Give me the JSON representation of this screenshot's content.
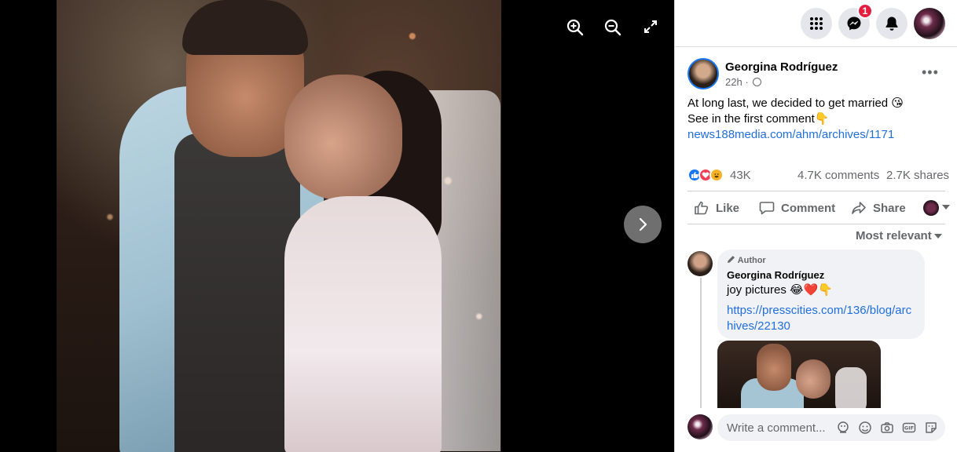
{
  "viewer": {
    "zoom_in_icon": "zoom-in-icon",
    "zoom_out_icon": "zoom-out-icon",
    "fullscreen_icon": "fullscreen-icon",
    "next_icon": "chevron-right-icon"
  },
  "topbar": {
    "menu_icon": "grid-icon",
    "messenger_icon": "messenger-icon",
    "messenger_badge": "1",
    "notifications_icon": "bell-icon"
  },
  "post": {
    "author": "Georgina Rodríguez",
    "time": "22h",
    "text_line1": "At long last, we decided to get married 😘",
    "text_line2": "See in the first comment👇",
    "link": "news188media.com/ahm/archives/1171",
    "reaction_count": "43K",
    "comments": "4.7K comments",
    "shares": "2.7K shares"
  },
  "actions": {
    "like": "Like",
    "comment": "Comment",
    "share": "Share"
  },
  "sort": {
    "label": "Most relevant"
  },
  "comment": {
    "tag": "Author",
    "name": "Georgina Rodríguez",
    "text": "joy pictures 😂❤️👇",
    "link": "https://presscities.com/136/blog/archives/22130"
  },
  "composer": {
    "placeholder": "Write a comment..."
  },
  "colors": {
    "accent": "#1877f2",
    "link": "#216fdb",
    "badge": "#e41e3f",
    "secondary_text": "#65676b"
  }
}
